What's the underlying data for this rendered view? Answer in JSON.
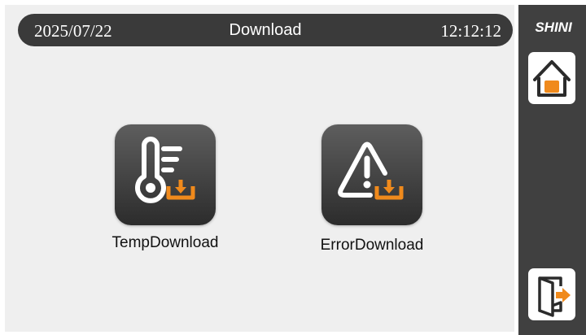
{
  "header": {
    "date": "2025/07/22",
    "title": "Download",
    "time": "12:12:12"
  },
  "brand": {
    "logo_text": "SHINI"
  },
  "sidebar": {
    "home_icon": "home-icon",
    "exit_icon": "exit-door-icon"
  },
  "tiles": [
    {
      "label": "TempDownload",
      "icon": "thermometer-download-icon"
    },
    {
      "label": "ErrorDownload",
      "icon": "warning-download-icon"
    }
  ],
  "colors": {
    "accent": "#f08a1c",
    "header_bg": "#3a3a3a",
    "sidebar_bg": "#404040",
    "main_bg": "#efefef"
  }
}
